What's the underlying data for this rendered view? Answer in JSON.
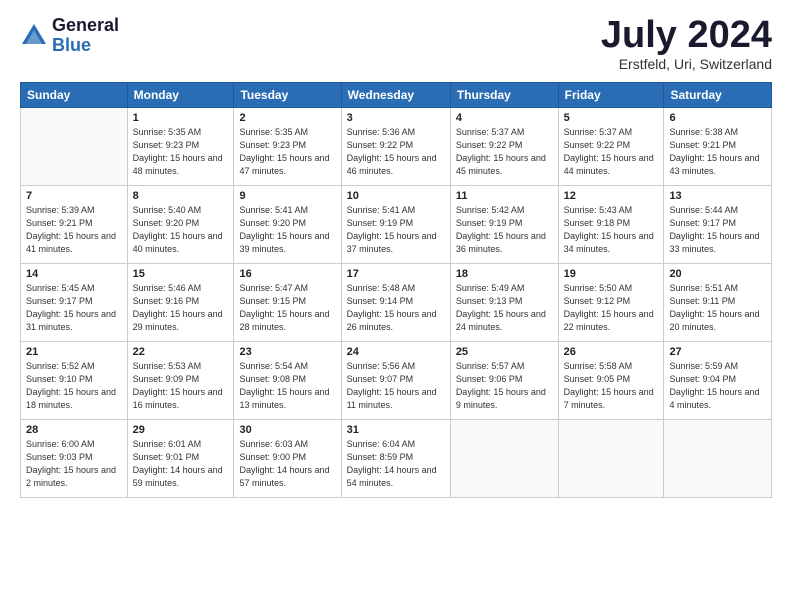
{
  "logo": {
    "general": "General",
    "blue": "Blue"
  },
  "title": "July 2024",
  "subtitle": "Erstfeld, Uri, Switzerland",
  "days_header": [
    "Sunday",
    "Monday",
    "Tuesday",
    "Wednesday",
    "Thursday",
    "Friday",
    "Saturday"
  ],
  "weeks": [
    [
      {
        "day": "",
        "sunrise": "",
        "sunset": "",
        "daylight": ""
      },
      {
        "day": "1",
        "sunrise": "Sunrise: 5:35 AM",
        "sunset": "Sunset: 9:23 PM",
        "daylight": "Daylight: 15 hours and 48 minutes."
      },
      {
        "day": "2",
        "sunrise": "Sunrise: 5:35 AM",
        "sunset": "Sunset: 9:23 PM",
        "daylight": "Daylight: 15 hours and 47 minutes."
      },
      {
        "day": "3",
        "sunrise": "Sunrise: 5:36 AM",
        "sunset": "Sunset: 9:22 PM",
        "daylight": "Daylight: 15 hours and 46 minutes."
      },
      {
        "day": "4",
        "sunrise": "Sunrise: 5:37 AM",
        "sunset": "Sunset: 9:22 PM",
        "daylight": "Daylight: 15 hours and 45 minutes."
      },
      {
        "day": "5",
        "sunrise": "Sunrise: 5:37 AM",
        "sunset": "Sunset: 9:22 PM",
        "daylight": "Daylight: 15 hours and 44 minutes."
      },
      {
        "day": "6",
        "sunrise": "Sunrise: 5:38 AM",
        "sunset": "Sunset: 9:21 PM",
        "daylight": "Daylight: 15 hours and 43 minutes."
      }
    ],
    [
      {
        "day": "7",
        "sunrise": "Sunrise: 5:39 AM",
        "sunset": "Sunset: 9:21 PM",
        "daylight": "Daylight: 15 hours and 41 minutes."
      },
      {
        "day": "8",
        "sunrise": "Sunrise: 5:40 AM",
        "sunset": "Sunset: 9:20 PM",
        "daylight": "Daylight: 15 hours and 40 minutes."
      },
      {
        "day": "9",
        "sunrise": "Sunrise: 5:41 AM",
        "sunset": "Sunset: 9:20 PM",
        "daylight": "Daylight: 15 hours and 39 minutes."
      },
      {
        "day": "10",
        "sunrise": "Sunrise: 5:41 AM",
        "sunset": "Sunset: 9:19 PM",
        "daylight": "Daylight: 15 hours and 37 minutes."
      },
      {
        "day": "11",
        "sunrise": "Sunrise: 5:42 AM",
        "sunset": "Sunset: 9:19 PM",
        "daylight": "Daylight: 15 hours and 36 minutes."
      },
      {
        "day": "12",
        "sunrise": "Sunrise: 5:43 AM",
        "sunset": "Sunset: 9:18 PM",
        "daylight": "Daylight: 15 hours and 34 minutes."
      },
      {
        "day": "13",
        "sunrise": "Sunrise: 5:44 AM",
        "sunset": "Sunset: 9:17 PM",
        "daylight": "Daylight: 15 hours and 33 minutes."
      }
    ],
    [
      {
        "day": "14",
        "sunrise": "Sunrise: 5:45 AM",
        "sunset": "Sunset: 9:17 PM",
        "daylight": "Daylight: 15 hours and 31 minutes."
      },
      {
        "day": "15",
        "sunrise": "Sunrise: 5:46 AM",
        "sunset": "Sunset: 9:16 PM",
        "daylight": "Daylight: 15 hours and 29 minutes."
      },
      {
        "day": "16",
        "sunrise": "Sunrise: 5:47 AM",
        "sunset": "Sunset: 9:15 PM",
        "daylight": "Daylight: 15 hours and 28 minutes."
      },
      {
        "day": "17",
        "sunrise": "Sunrise: 5:48 AM",
        "sunset": "Sunset: 9:14 PM",
        "daylight": "Daylight: 15 hours and 26 minutes."
      },
      {
        "day": "18",
        "sunrise": "Sunrise: 5:49 AM",
        "sunset": "Sunset: 9:13 PM",
        "daylight": "Daylight: 15 hours and 24 minutes."
      },
      {
        "day": "19",
        "sunrise": "Sunrise: 5:50 AM",
        "sunset": "Sunset: 9:12 PM",
        "daylight": "Daylight: 15 hours and 22 minutes."
      },
      {
        "day": "20",
        "sunrise": "Sunrise: 5:51 AM",
        "sunset": "Sunset: 9:11 PM",
        "daylight": "Daylight: 15 hours and 20 minutes."
      }
    ],
    [
      {
        "day": "21",
        "sunrise": "Sunrise: 5:52 AM",
        "sunset": "Sunset: 9:10 PM",
        "daylight": "Daylight: 15 hours and 18 minutes."
      },
      {
        "day": "22",
        "sunrise": "Sunrise: 5:53 AM",
        "sunset": "Sunset: 9:09 PM",
        "daylight": "Daylight: 15 hours and 16 minutes."
      },
      {
        "day": "23",
        "sunrise": "Sunrise: 5:54 AM",
        "sunset": "Sunset: 9:08 PM",
        "daylight": "Daylight: 15 hours and 13 minutes."
      },
      {
        "day": "24",
        "sunrise": "Sunrise: 5:56 AM",
        "sunset": "Sunset: 9:07 PM",
        "daylight": "Daylight: 15 hours and 11 minutes."
      },
      {
        "day": "25",
        "sunrise": "Sunrise: 5:57 AM",
        "sunset": "Sunset: 9:06 PM",
        "daylight": "Daylight: 15 hours and 9 minutes."
      },
      {
        "day": "26",
        "sunrise": "Sunrise: 5:58 AM",
        "sunset": "Sunset: 9:05 PM",
        "daylight": "Daylight: 15 hours and 7 minutes."
      },
      {
        "day": "27",
        "sunrise": "Sunrise: 5:59 AM",
        "sunset": "Sunset: 9:04 PM",
        "daylight": "Daylight: 15 hours and 4 minutes."
      }
    ],
    [
      {
        "day": "28",
        "sunrise": "Sunrise: 6:00 AM",
        "sunset": "Sunset: 9:03 PM",
        "daylight": "Daylight: 15 hours and 2 minutes."
      },
      {
        "day": "29",
        "sunrise": "Sunrise: 6:01 AM",
        "sunset": "Sunset: 9:01 PM",
        "daylight": "Daylight: 14 hours and 59 minutes."
      },
      {
        "day": "30",
        "sunrise": "Sunrise: 6:03 AM",
        "sunset": "Sunset: 9:00 PM",
        "daylight": "Daylight: 14 hours and 57 minutes."
      },
      {
        "day": "31",
        "sunrise": "Sunrise: 6:04 AM",
        "sunset": "Sunset: 8:59 PM",
        "daylight": "Daylight: 14 hours and 54 minutes."
      },
      {
        "day": "",
        "sunrise": "",
        "sunset": "",
        "daylight": ""
      },
      {
        "day": "",
        "sunrise": "",
        "sunset": "",
        "daylight": ""
      },
      {
        "day": "",
        "sunrise": "",
        "sunset": "",
        "daylight": ""
      }
    ]
  ]
}
